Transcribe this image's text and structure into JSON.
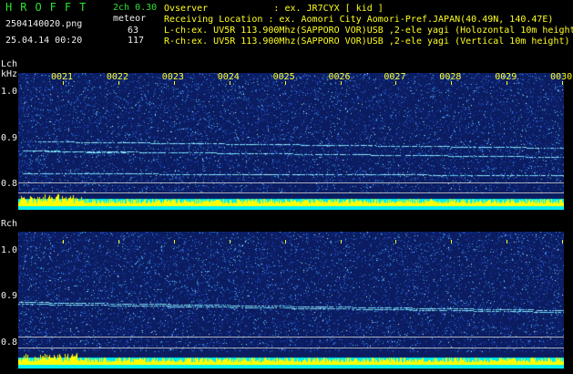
{
  "header": {
    "app_name": "HROFFT",
    "version": "2ch 0.30",
    "mode": "meteor",
    "filename": "2504140020.png",
    "datetime": "25.04.14 00:20",
    "lch_count": "63",
    "rch_count": "117",
    "observer_line": "Ovserver            : ex. JR7CYX [ kid ]",
    "location_line": "Receiving Location : ex. Aomori City Aomori-Pref.JAPAN(40.49N, 140.47E)",
    "lch_line": "L-ch:ex. UV5R 113.900Mhz(SAPPORO VOR)USB ,2-ele yagi (Holozontal 10m height",
    "rch_line": "R-ch:ex. UV5R 113.900Mhz(SAPPORO VOR)USB ,2-ele yagi (Vertical 10m height)"
  },
  "time_labels": [
    "0021",
    "0022",
    "0023",
    "0024",
    "0025",
    "0026",
    "0027",
    "0028",
    "0029",
    "0030"
  ],
  "lch": {
    "label": "Lch",
    "unit": "kHz",
    "ticks": [
      "1.0",
      "0.9",
      "0.8"
    ]
  },
  "rch": {
    "label": "Rch",
    "ticks": [
      "1.0",
      "0.9",
      "0.8"
    ]
  },
  "colors": {
    "background": "#000000",
    "spectrum": "#0a1a5a",
    "text_yellow": "#ffff20",
    "text_green": "#30e030",
    "text_white": "#f0f0f0",
    "level_cyan": "#00f0f0",
    "level_yellow": "#ffff00"
  }
}
